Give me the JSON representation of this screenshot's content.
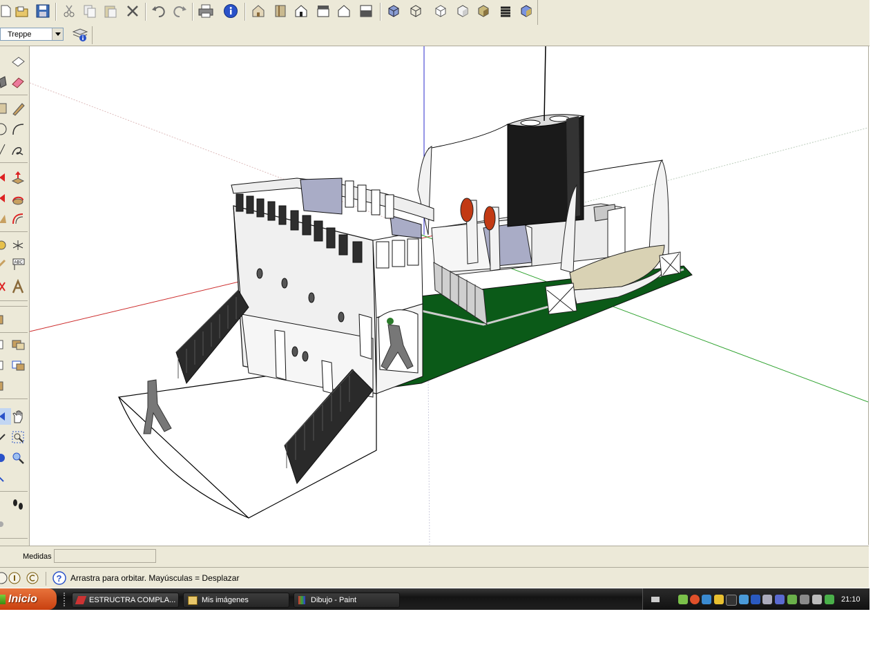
{
  "toolbar": {
    "layer_value": "Treppe",
    "icons": [
      "new-icon",
      "open-icon",
      "save-icon",
      "cut-icon",
      "copy-icon",
      "paste-icon",
      "erase-icon",
      "undo-icon",
      "redo-icon",
      "print-icon",
      "model-info-icon",
      "iso-view-icon",
      "top-view-icon",
      "front-view-icon",
      "right-view-icon",
      "back-view-icon",
      "left-view-icon",
      "xray-icon",
      "wireframe-icon",
      "hidden-line-icon",
      "shaded-icon",
      "shaded-textures-icon",
      "monochrome-icon"
    ]
  },
  "measurements": {
    "label": "Medidas",
    "value": ""
  },
  "status": {
    "hint": "Arrastra para orbitar. Mayúsculas = Desplazar"
  },
  "taskbar": {
    "start_label": "Inicio",
    "tasks": [
      {
        "label": "ESTRUCTRA COMPLA..."
      },
      {
        "label": "Mis imágenes"
      },
      {
        "label": "Dibujo - Paint"
      }
    ],
    "clock": "21:10"
  },
  "colors": {
    "toolbar_bg": "#ece9d8",
    "taskbar_bg": "#1f1f1f",
    "start_button": "#d54a16",
    "deck_green": "#0b5a18",
    "axis_red": "#cc2a2a",
    "axis_green": "#2aa02a",
    "axis_blue": "#2a2acc"
  }
}
